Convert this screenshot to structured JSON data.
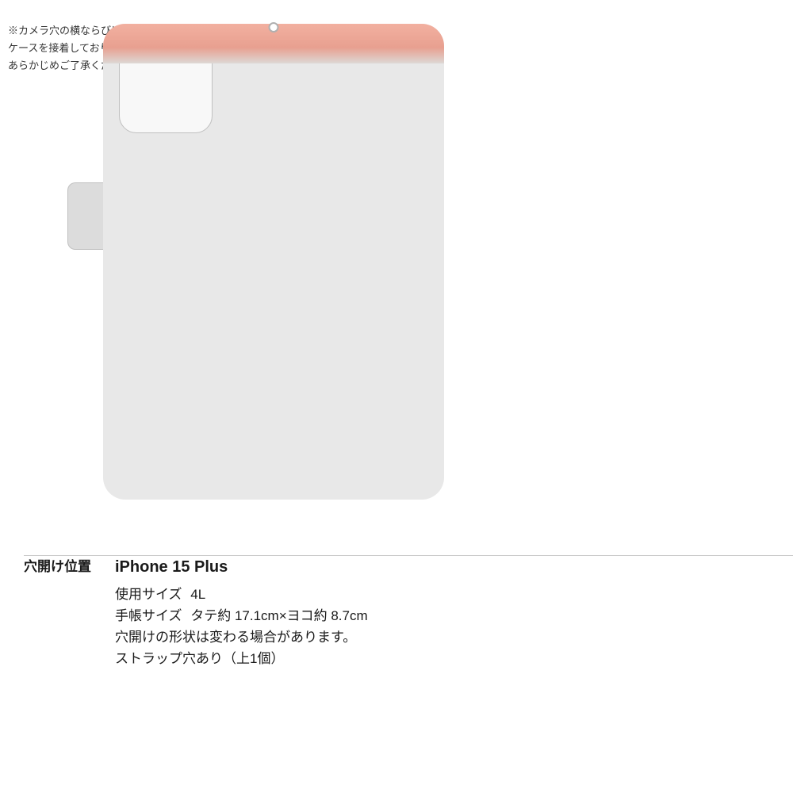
{
  "page": {
    "background": "#ffffff"
  },
  "note": {
    "lines": [
      "※カメラ穴の横ならびに上部は",
      "ケースを接着しておりません。",
      "あらかじめご了承ください。"
    ]
  },
  "info_section": {
    "label": "穴開け位置",
    "device": "iPhone 15 Plus",
    "size_label": "使用サイズ",
    "size_value": "4L",
    "notebook_label": "手帳サイズ",
    "notebook_value": "タテ約 17.1cm×ヨコ約 8.7cm",
    "shape_note": "穴開けの形状は変わる場合があります。",
    "strap_note": "ストラップ穴あり（上1個）"
  },
  "icons": {
    "strap_hole": "○",
    "camera_box": "□"
  }
}
